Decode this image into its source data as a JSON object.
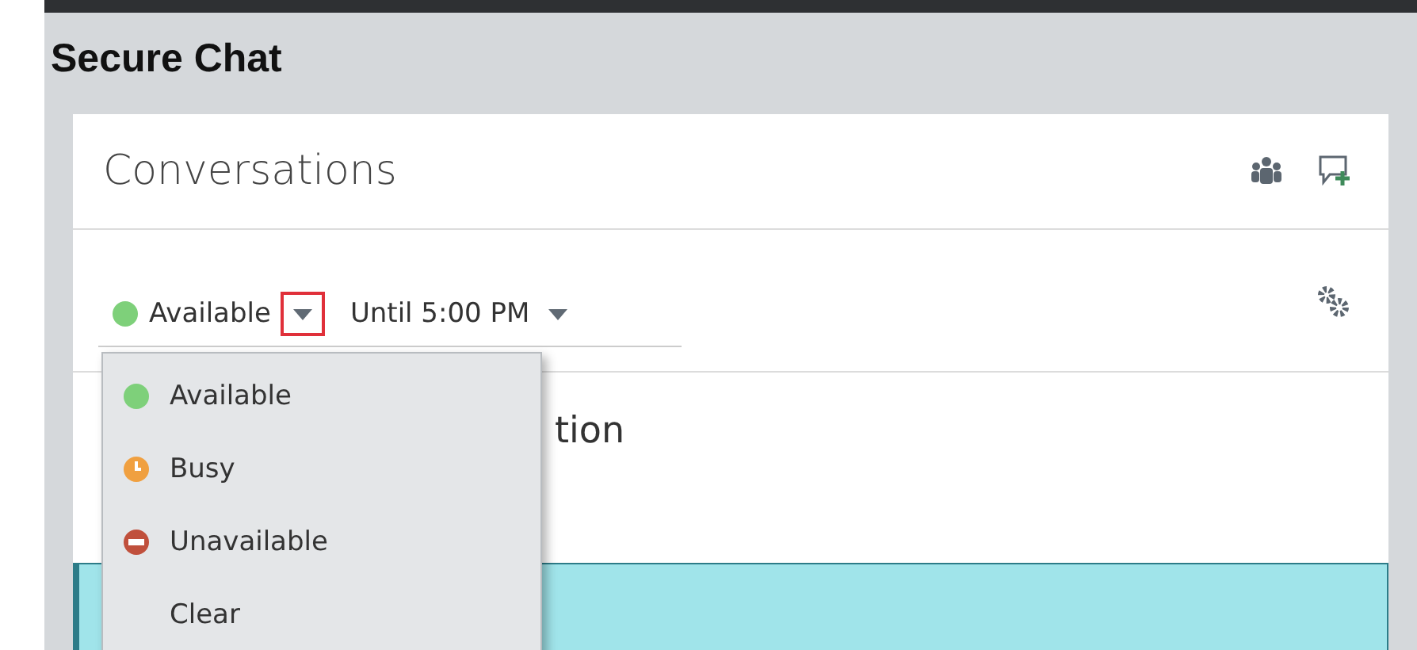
{
  "page_title": "Secure Chat",
  "panel": {
    "title": "Conversations"
  },
  "status": {
    "kind": "available",
    "label": "Available",
    "caret_highlighted": true,
    "until": "Until 5:00 PM"
  },
  "status_menu": [
    {
      "kind": "available",
      "label": "Available"
    },
    {
      "kind": "busy",
      "label": "Busy"
    },
    {
      "kind": "unavailable",
      "label": "Unavailable"
    },
    {
      "kind": "none",
      "label": "Clear"
    }
  ],
  "hidden_text": "tion"
}
